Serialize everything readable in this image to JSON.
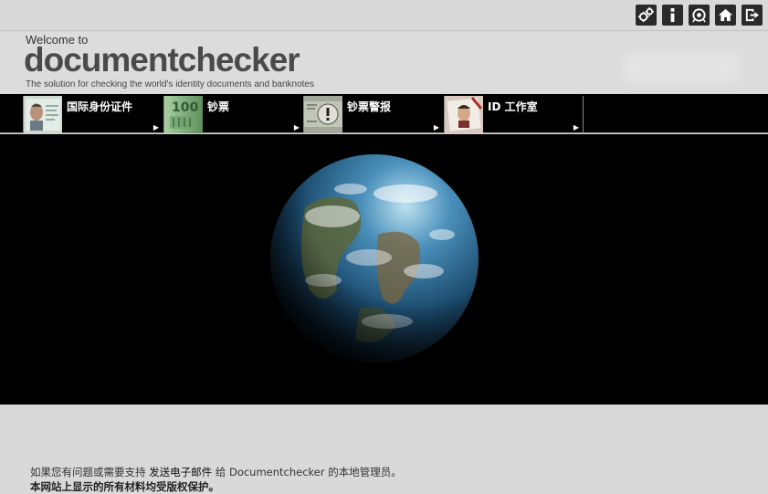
{
  "toolbar": {
    "icons": [
      "settings-icon",
      "info-icon",
      "support-icon",
      "home-icon",
      "logout-icon"
    ]
  },
  "header": {
    "welcome": "Welcome to",
    "brand": "documentchecker",
    "tagline": "The solution for checking the world's identity documents and banknotes"
  },
  "nav": {
    "tabs": [
      {
        "label": "国际身份证件"
      },
      {
        "label": "钞票"
      },
      {
        "label": "钞票警报"
      },
      {
        "label": "ID 工作室"
      }
    ],
    "arrow": "▶"
  },
  "footer": {
    "prefix": "如果您有问题或需要支持",
    "link": "发送电子邮件",
    "suffix": "给 Documentchecker 的本地管理员。",
    "copyright": "本网站上显示的所有材料均受版权保护。"
  },
  "colors": {
    "background": "#d9d9d9",
    "navbar": "#000000",
    "brand_text": "#4a4a4a"
  }
}
